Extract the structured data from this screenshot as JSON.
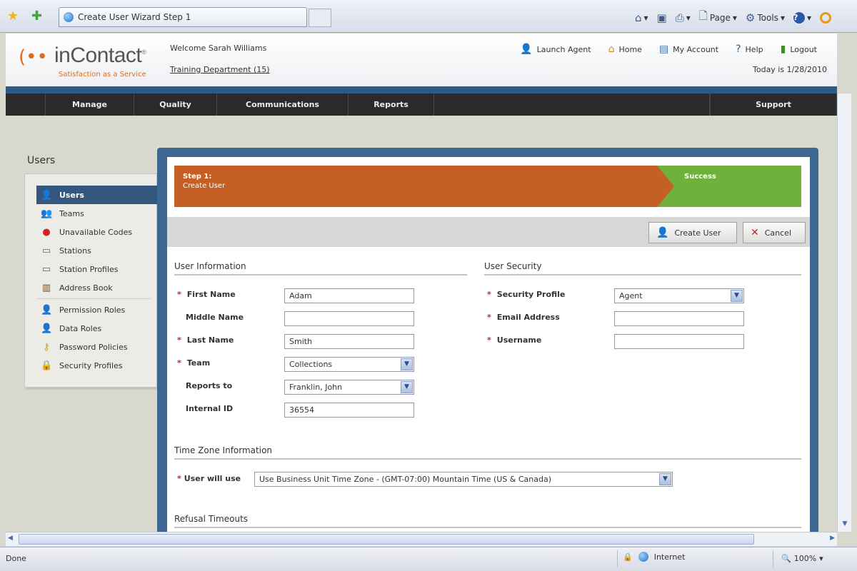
{
  "browser": {
    "tab_title": "Create User Wizard Step 1",
    "commands": [
      "Page",
      "Tools"
    ]
  },
  "header": {
    "logo_text": "inContact",
    "logo_tagline": "Satisfaction as a Service",
    "welcome": "Welcome Sarah Williams",
    "department": "Training Department (15)",
    "links": [
      "Launch Agent",
      "Home",
      "My Account",
      "Help",
      "Logout"
    ],
    "today": "Today is 1/28/2010"
  },
  "nav": [
    "Manage",
    "Quality",
    "Communications",
    "Reports",
    "Support"
  ],
  "sidebar": {
    "title": "Users",
    "items": [
      "Users",
      "Teams",
      "Unavailable Codes",
      "Stations",
      "Station Profiles",
      "Address Book",
      "Permission Roles",
      "Data Roles",
      "Password Policies",
      "Security Profiles"
    ]
  },
  "wizard": {
    "step1_title": "Step 1:",
    "step1_sub": "Create User",
    "step2_title": "Success"
  },
  "actions": {
    "create": "Create User",
    "cancel": "Cancel"
  },
  "user_info": {
    "title": "User Information",
    "first_name_label": "First Name",
    "first_name": "Adam",
    "middle_name_label": "Middle Name",
    "middle_name": "",
    "last_name_label": "Last Name",
    "last_name": "Smith",
    "team_label": "Team",
    "team": "Collections",
    "reports_to_label": "Reports to",
    "reports_to": "Franklin, John",
    "internal_id_label": "Internal ID",
    "internal_id": "36554"
  },
  "user_security": {
    "title": "User Security",
    "profile_label": "Security Profile",
    "profile": "Agent",
    "email_label": "Email Address",
    "email": "",
    "username_label": "Username",
    "username": ""
  },
  "time_zone": {
    "title": "Time Zone Information",
    "label": "User will use",
    "value": "Use Business Unit Time Zone - (GMT-07:00) Mountain Time (US & Canada)"
  },
  "refusal": {
    "title": "Refusal Timeouts"
  },
  "status": {
    "done": "Done",
    "zone": "Internet",
    "zoom": "100%"
  }
}
